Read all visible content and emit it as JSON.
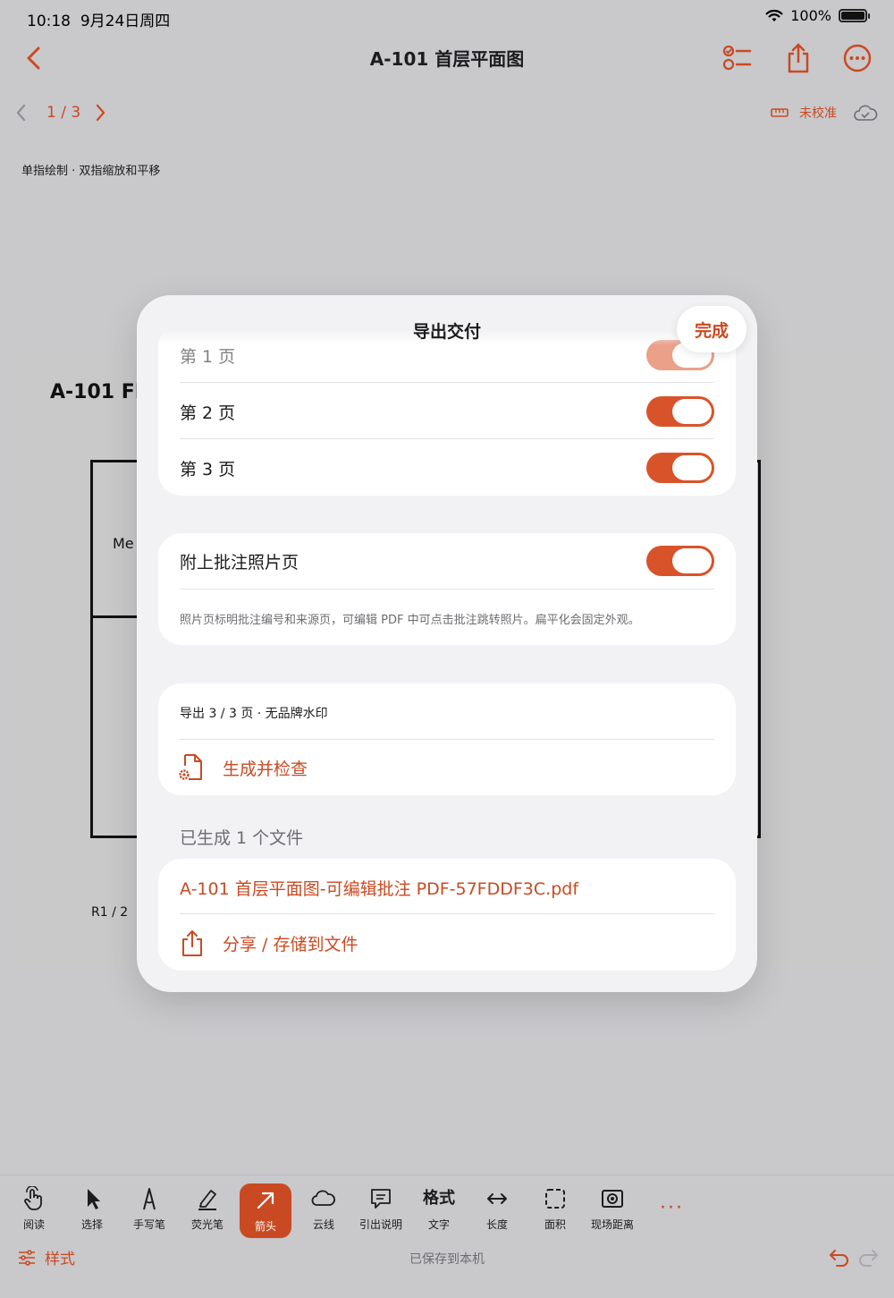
{
  "status_bar": {
    "time": "10:18",
    "date": "9月24日周四",
    "battery": "100%"
  },
  "nav": {
    "title": "A-101 首层平面图",
    "icons": [
      "chevron-left-icon",
      "checklist-icon",
      "share-icon",
      "more-icon"
    ]
  },
  "pager": {
    "text": "1 / 3"
  },
  "calibration": {
    "label": "未校准"
  },
  "hint": "单指绘制 · 双指缩放和平移",
  "document": {
    "title": "A-101 FI",
    "room_label": "Me",
    "footer": "R1  /  2"
  },
  "modal": {
    "title": "导出交付",
    "done_label": "完成",
    "pages": [
      {
        "label": "第 1 页",
        "on": true
      },
      {
        "label": "第 2 页",
        "on": true
      },
      {
        "label": "第 3 页",
        "on": true
      }
    ],
    "photo_pages": {
      "label": "附上批注照片页",
      "on": true,
      "note": "照片页标明批注编号和来源页，可编辑 PDF 中可点击批注跳转照片。扁平化会固定外观。"
    },
    "export": {
      "summary": "导出 3 / 3 页 · 无品牌水印",
      "generate_label": "生成并检查"
    },
    "generated": {
      "header": "已生成 1 个文件",
      "file_name": "A-101 首层平面图-可编辑批注 PDF-57FDDF3C.pdf",
      "share_label": "分享 / 存储到文件"
    }
  },
  "toolbar": {
    "tools": [
      {
        "label": "阅读",
        "icon": "hand-icon"
      },
      {
        "label": "选择",
        "icon": "cursor-icon"
      },
      {
        "label": "手写笔",
        "icon": "pen-nib-icon"
      },
      {
        "label": "荧光笔",
        "icon": "highlighter-icon"
      },
      {
        "label": "箭头",
        "icon": "arrow-icon",
        "active": true
      },
      {
        "label": "云线",
        "icon": "cloud-icon"
      },
      {
        "label": "引出说明",
        "icon": "callout-icon"
      },
      {
        "label": "文字",
        "icon_text": "格式"
      },
      {
        "label": "长度",
        "icon": "length-icon"
      },
      {
        "label": "面积",
        "icon": "area-icon"
      },
      {
        "label": "现场距离",
        "icon": "camera-distance-icon"
      }
    ],
    "more": "···",
    "style_label": "样式",
    "saved_text": "已保存到本机"
  },
  "colors": {
    "accent": "#c94a22",
    "toggle_on": "#d9532a",
    "background": "#c9c8cb"
  }
}
